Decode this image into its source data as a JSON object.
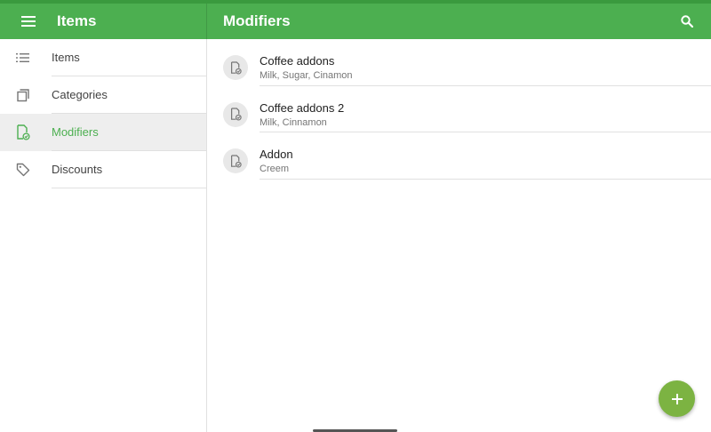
{
  "appbar": {
    "left_title": "Items",
    "right_title": "Modifiers",
    "menu_icon": "hamburger-icon",
    "search_icon": "search-icon"
  },
  "sidebar": {
    "items": [
      {
        "label": "Items",
        "icon": "list-icon",
        "active": false
      },
      {
        "label": "Categories",
        "icon": "copy-icon",
        "active": false
      },
      {
        "label": "Modifiers",
        "icon": "modifier-icon",
        "active": true
      },
      {
        "label": "Discounts",
        "icon": "tag-icon",
        "active": false
      }
    ]
  },
  "modifiers": [
    {
      "title": "Coffee addons",
      "subtitle": "Milk, Sugar, Cinamon"
    },
    {
      "title": "Coffee addons 2",
      "subtitle": "Milk, Cinnamon"
    },
    {
      "title": "Addon",
      "subtitle": "Creem"
    }
  ],
  "fab": {
    "icon": "plus-icon"
  },
  "colors": {
    "primary": "#4caf50",
    "primary_dark": "#3a9a3e",
    "accent": "#7cb342",
    "active_bg": "#eeeeee"
  }
}
